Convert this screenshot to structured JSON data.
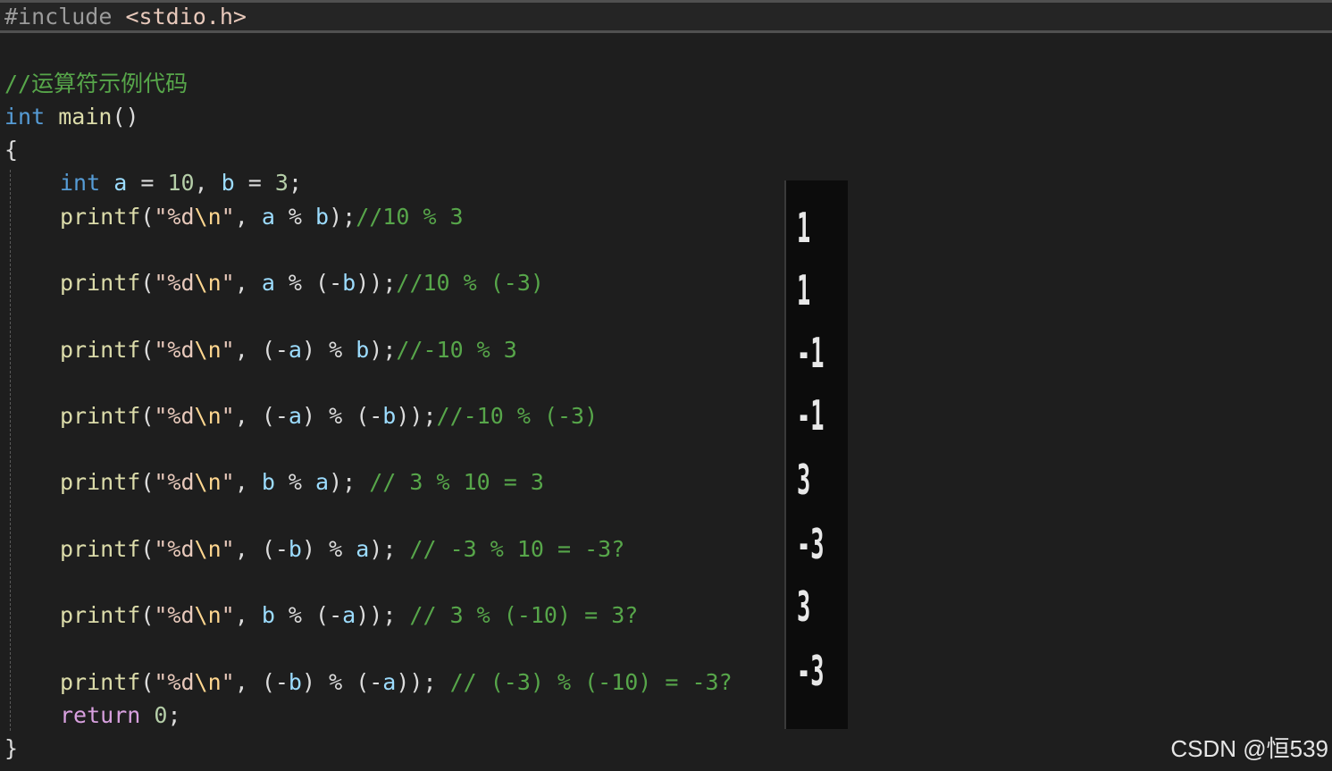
{
  "include": {
    "directive": "#include",
    "header": "<stdio.h>"
  },
  "comment_title": "//运算符示例代码",
  "main_sig": {
    "type": "int",
    "name": "main",
    "parens": "()"
  },
  "open_brace": "{",
  "close_brace": "}",
  "decl": {
    "type": "int",
    "a": "a",
    "eq1": " = ",
    "a_val": "10",
    "comma": ", ",
    "b": "b",
    "eq2": " = ",
    "b_val": "3",
    "semi": ";"
  },
  "statements": [
    {
      "fn": "printf",
      "open": "(",
      "fmt": "\"%d",
      "esc": "\\n",
      "fmt_end": "\"",
      "sep": ", ",
      "expr": [
        [
          "var",
          "a"
        ],
        [
          "op",
          " % "
        ],
        [
          "var",
          "b"
        ]
      ],
      "close": ");",
      "comment": "//10 % 3"
    },
    {
      "fn": "printf",
      "open": "(",
      "fmt": "\"%d",
      "esc": "\\n",
      "fmt_end": "\"",
      "sep": ", ",
      "expr": [
        [
          "var",
          "a"
        ],
        [
          "op",
          " % ("
        ],
        [
          "op",
          "-"
        ],
        [
          "var",
          "b"
        ],
        [
          "op",
          ")"
        ]
      ],
      "close": ");",
      "comment": "//10 % (-3)"
    },
    {
      "fn": "printf",
      "open": "(",
      "fmt": "\"%d",
      "esc": "\\n",
      "fmt_end": "\"",
      "sep": ", ",
      "expr": [
        [
          "op",
          "(-"
        ],
        [
          "var",
          "a"
        ],
        [
          "op",
          ") % "
        ],
        [
          "var",
          "b"
        ]
      ],
      "close": ");",
      "comment": "//-10 % 3"
    },
    {
      "fn": "printf",
      "open": "(",
      "fmt": "\"%d",
      "esc": "\\n",
      "fmt_end": "\"",
      "sep": ", ",
      "expr": [
        [
          "op",
          "(-"
        ],
        [
          "var",
          "a"
        ],
        [
          "op",
          ") % (-"
        ],
        [
          "var",
          "b"
        ],
        [
          "op",
          ")"
        ]
      ],
      "close": ");",
      "comment": "//-10 % (-3)"
    },
    {
      "fn": "printf",
      "open": "(",
      "fmt": "\"%d",
      "esc": "\\n",
      "fmt_end": "\"",
      "sep": ", ",
      "expr": [
        [
          "var",
          "b"
        ],
        [
          "op",
          " % "
        ],
        [
          "var",
          "a"
        ]
      ],
      "close": "); ",
      "comment": "// 3 % 10 = 3"
    },
    {
      "fn": "printf",
      "open": "(",
      "fmt": "\"%d",
      "esc": "\\n",
      "fmt_end": "\"",
      "sep": ", ",
      "expr": [
        [
          "op",
          "(-"
        ],
        [
          "var",
          "b"
        ],
        [
          "op",
          ") % "
        ],
        [
          "var",
          "a"
        ]
      ],
      "close": "); ",
      "comment": "// -3 % 10 = -3?"
    },
    {
      "fn": "printf",
      "open": "(",
      "fmt": "\"%d",
      "esc": "\\n",
      "fmt_end": "\"",
      "sep": ", ",
      "expr": [
        [
          "var",
          "b"
        ],
        [
          "op",
          " % (-"
        ],
        [
          "var",
          "a"
        ],
        [
          "op",
          ")"
        ]
      ],
      "close": "); ",
      "comment": "// 3 % (-10) = 3?"
    },
    {
      "fn": "printf",
      "open": "(",
      "fmt": "\"%d",
      "esc": "\\n",
      "fmt_end": "\"",
      "sep": ", ",
      "expr": [
        [
          "op",
          "(-"
        ],
        [
          "var",
          "b"
        ],
        [
          "op",
          ") % (-"
        ],
        [
          "var",
          "a"
        ],
        [
          "op",
          ")"
        ]
      ],
      "close": "); ",
      "comment": "// (-3) % (-10) = -3?"
    }
  ],
  "return_stmt": {
    "kw": "return",
    "val": "0",
    "semi": ";"
  },
  "console_output": [
    "1",
    "1",
    "-1",
    "-1",
    "3",
    "-3",
    "3",
    "-3"
  ],
  "watermark": "CSDN @恒539"
}
